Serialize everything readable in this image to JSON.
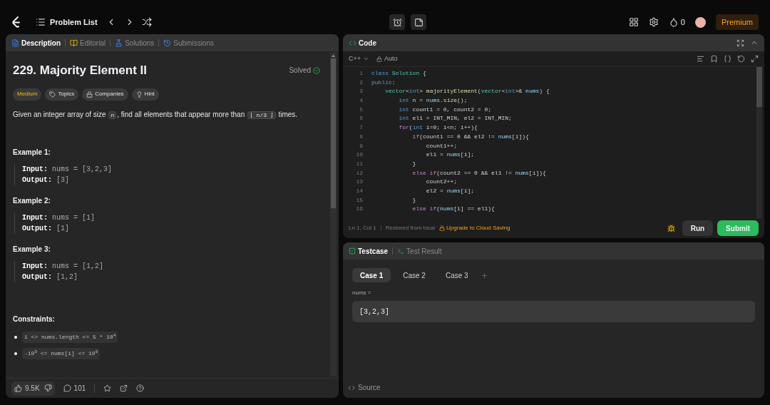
{
  "nav": {
    "problem_list": "Problem List",
    "streak": "0",
    "premium": "Premium"
  },
  "description_tabs": [
    {
      "kind": "description",
      "label": "Description",
      "selected": true
    },
    {
      "kind": "editorial",
      "label": "Editorial",
      "selected": false
    },
    {
      "kind": "solutions",
      "label": "Solutions",
      "selected": false
    },
    {
      "kind": "submissions",
      "label": "Submissions",
      "selected": false
    }
  ],
  "problem": {
    "title": "229. Majority Element II",
    "status": "Solved",
    "tags": [
      {
        "kind": "difficulty",
        "label": "Medium"
      },
      {
        "kind": "topics",
        "label": "Topics"
      },
      {
        "kind": "companies",
        "label": "Companies"
      },
      {
        "kind": "hint",
        "label": "Hint"
      }
    ],
    "statement": [
      {
        "kind": "text",
        "text": "Given an integer array of size "
      },
      {
        "kind": "code",
        "text": "n"
      },
      {
        "kind": "text",
        "text": ", find all elements that appear more than "
      },
      {
        "kind": "code",
        "text": "⌊ n/3 ⌋"
      },
      {
        "kind": "text",
        "text": " times."
      }
    ],
    "examples": [
      {
        "title": "Example 1:",
        "lines": [
          {
            "label": "Input:",
            "value": "nums = [3,2,3]"
          },
          {
            "label": "Output:",
            "value": "[3]"
          }
        ]
      },
      {
        "title": "Example 2:",
        "lines": [
          {
            "label": "Input:",
            "value": "nums = [1]"
          },
          {
            "label": "Output:",
            "value": "[1]"
          }
        ]
      },
      {
        "title": "Example 3:",
        "lines": [
          {
            "label": "Input:",
            "value": "nums = [1,2]"
          },
          {
            "label": "Output:",
            "value": "[1,2]"
          }
        ]
      }
    ],
    "constraints_title": "Constraints:",
    "constraints": [
      "1 <= nums.length <= 5 * 10$^{4}$",
      "-10$^{9}$ <= nums[i] <= 10$^{9}$"
    ]
  },
  "footer": {
    "likes": "9.5K",
    "comments": "101"
  },
  "code_panel": {
    "title": "Code",
    "language": "C++",
    "mode": "Auto",
    "lines": [
      {
        "number": "1",
        "tokens": [
          {
            "kind": "kw",
            "text": "class "
          },
          {
            "kind": "type",
            "text": "Solution"
          },
          {
            "kind": "plain",
            "text": " {"
          }
        ]
      },
      {
        "number": "2",
        "tokens": [
          {
            "kind": "kw",
            "text": "public"
          },
          {
            "kind": "plain",
            "text": ":"
          }
        ]
      },
      {
        "number": "3",
        "tokens": [
          {
            "kind": "type",
            "text": "    vector"
          },
          {
            "kind": "plain",
            "text": "<"
          },
          {
            "kind": "kw",
            "text": "int"
          },
          {
            "kind": "plain",
            "text": "> "
          },
          {
            "kind": "fn",
            "text": "majorityElement"
          },
          {
            "kind": "plain",
            "text": "("
          },
          {
            "kind": "type",
            "text": "vector"
          },
          {
            "kind": "plain",
            "text": "<"
          },
          {
            "kind": "kw",
            "text": "int"
          },
          {
            "kind": "plain",
            "text": ">& "
          },
          {
            "kind": "var",
            "text": "nums"
          },
          {
            "kind": "plain",
            "text": ") {"
          }
        ]
      },
      {
        "number": "4",
        "tokens": [
          {
            "kind": "kw",
            "text": "        int"
          },
          {
            "kind": "plain",
            "text": " n = "
          },
          {
            "kind": "var",
            "text": "nums"
          },
          {
            "kind": "plain",
            "text": "."
          },
          {
            "kind": "fn",
            "text": "size"
          },
          {
            "kind": "plain",
            "text": "();"
          }
        ]
      },
      {
        "number": "5",
        "tokens": [
          {
            "kind": "kw",
            "text": "        int"
          },
          {
            "kind": "plain",
            "text": " count1 = 0, count2 = 0;"
          }
        ]
      },
      {
        "number": "6",
        "tokens": [
          {
            "kind": "kw",
            "text": "        int"
          },
          {
            "kind": "plain",
            "text": " el1 = INT_MIN, el2 = INT_MIN;"
          }
        ]
      },
      {
        "number": "7",
        "tokens": [
          {
            "kind": "ctrl",
            "text": "        for"
          },
          {
            "kind": "plain",
            "text": "("
          },
          {
            "kind": "kw",
            "text": "int"
          },
          {
            "kind": "plain",
            "text": " i=0; i<n; i++){"
          }
        ]
      },
      {
        "number": "8",
        "tokens": [
          {
            "kind": "ctrl",
            "text": "            if"
          },
          {
            "kind": "plain",
            "text": "(count1 == 0 && el2 != "
          },
          {
            "kind": "var",
            "text": "nums"
          },
          {
            "kind": "plain",
            "text": "[i]){"
          }
        ]
      },
      {
        "number": "9",
        "tokens": [
          {
            "kind": "plain",
            "text": "                count1++;"
          }
        ]
      },
      {
        "number": "10",
        "tokens": [
          {
            "kind": "plain",
            "text": "                el1 = "
          },
          {
            "kind": "var",
            "text": "nums"
          },
          {
            "kind": "plain",
            "text": "[i];"
          }
        ]
      },
      {
        "number": "11",
        "tokens": [
          {
            "kind": "plain",
            "text": "            }"
          }
        ]
      },
      {
        "number": "12",
        "tokens": [
          {
            "kind": "ctrl",
            "text": "            else if"
          },
          {
            "kind": "plain",
            "text": "(count2 == 0 && el1 != "
          },
          {
            "kind": "var",
            "text": "nums"
          },
          {
            "kind": "plain",
            "text": "[i]){"
          }
        ]
      },
      {
        "number": "13",
        "tokens": [
          {
            "kind": "plain",
            "text": "                count2++;"
          }
        ]
      },
      {
        "number": "14",
        "tokens": [
          {
            "kind": "plain",
            "text": "                el2 = "
          },
          {
            "kind": "var",
            "text": "nums"
          },
          {
            "kind": "plain",
            "text": "[i];"
          }
        ]
      },
      {
        "number": "15",
        "tokens": [
          {
            "kind": "plain",
            "text": "            }"
          }
        ]
      },
      {
        "number": "16",
        "tokens": [
          {
            "kind": "ctrl",
            "text": "            else if"
          },
          {
            "kind": "plain",
            "text": "("
          },
          {
            "kind": "var",
            "text": "nums"
          },
          {
            "kind": "plain",
            "text": "[i] == el1){"
          }
        ]
      }
    ],
    "cursor": "Ln 1, Col 1",
    "saved": "Restored from local",
    "upgrade": "Upgrade to Cloud Saving",
    "run": "Run",
    "submit": "Submit"
  },
  "test_tabs": [
    {
      "kind": "testcase",
      "label": "Testcase",
      "selected": true
    },
    {
      "kind": "result",
      "label": "Test Result",
      "selected": false
    }
  ],
  "cases": [
    {
      "label": "Case 1",
      "selected": true
    },
    {
      "label": "Case 2",
      "selected": false
    },
    {
      "label": "Case 3",
      "selected": false
    }
  ],
  "input": {
    "label": "nums =",
    "value": "[3,2,3]"
  },
  "source": "Source"
}
